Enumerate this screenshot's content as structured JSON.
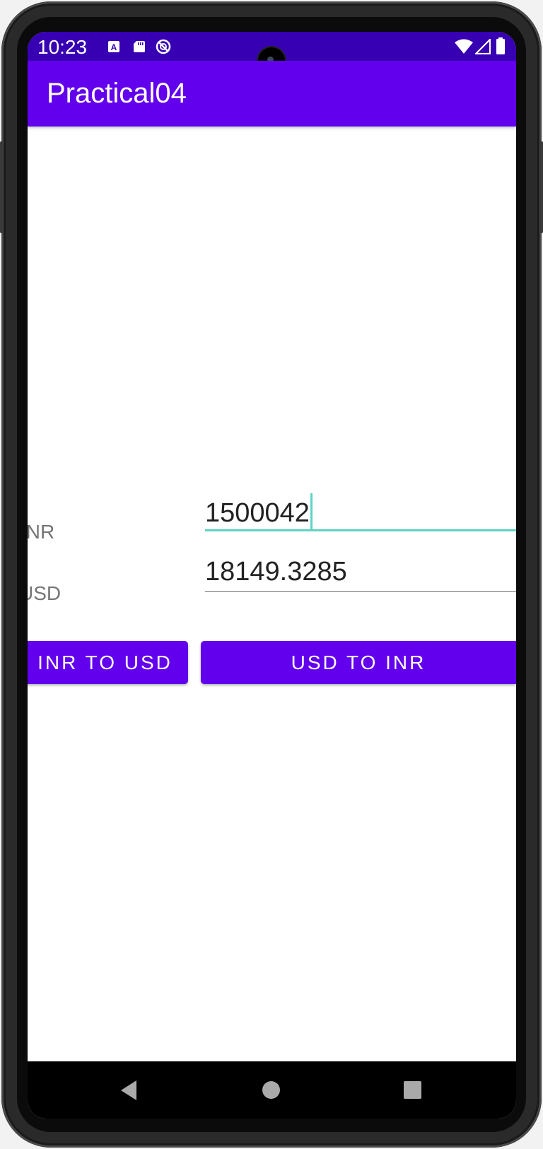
{
  "status_bar": {
    "time": "10:23",
    "left_icons": [
      "a-box-icon",
      "sd-card-icon",
      "no-location-icon"
    ],
    "right_icons": [
      "wifi-icon",
      "signal-icon",
      "battery-icon"
    ],
    "color": "#3700b3"
  },
  "app_bar": {
    "title": "Practical04",
    "color": "#6200ee"
  },
  "form": {
    "inr_label": "INR",
    "inr_value": "1500042",
    "usd_label": "USD",
    "usd_value": "18149.3285",
    "focus_color": "#5ed3c3"
  },
  "buttons": {
    "inr_to_usd": "INR TO USD",
    "usd_to_inr": "USD TO INR"
  },
  "nav_bar": {
    "icons": [
      "back-icon",
      "home-icon",
      "recents-icon"
    ]
  }
}
